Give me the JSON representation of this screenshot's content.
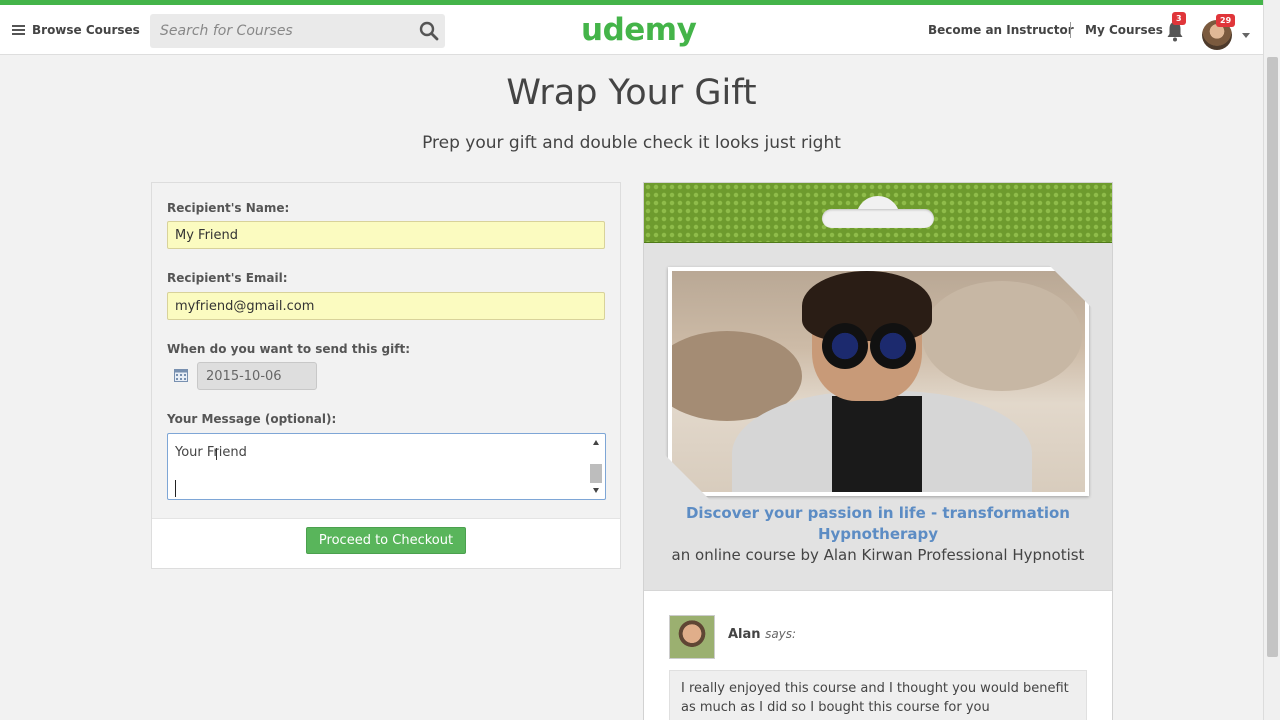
{
  "header": {
    "browse_label": "Browse Courses",
    "search_placeholder": "Search for Courses",
    "logo_text": "udemy",
    "become_instructor": "Become an Instructor",
    "my_courses": "My Courses",
    "notifications_count": "3",
    "messages_count": "29"
  },
  "page": {
    "title": "Wrap Your Gift",
    "subtitle": "Prep your gift and double check it looks just right"
  },
  "form": {
    "name_label": "Recipient's Name:",
    "name_value": "My Friend",
    "email_label": "Recipient's Email:",
    "email_value": "myfriend@gmail.com",
    "date_label": "When do you want to send this gift:",
    "date_value": "2015-10-06",
    "message_label": "Your Message (optional):",
    "message_value": "Your Friend",
    "checkout_label": "Proceed to Checkout"
  },
  "gift_card": {
    "course_title": "Discover your passion in life - transformation Hypnotherapy",
    "course_byline": "an online course by Alan Kirwan Professional Hypnotist",
    "sender_name": "Alan",
    "says_text": "says:",
    "message": "I really enjoyed this course and I thought you would benefit as much as I did so I bought this course for you"
  },
  "colors": {
    "brand_green": "#44b449",
    "checkout_green": "#59b55b",
    "link_blue": "#5c8cc4",
    "input_yellow": "#fbfbc0",
    "badge_red": "#e0363a"
  },
  "icons": [
    "menu-icon",
    "search-icon",
    "bell-icon",
    "calendar-icon",
    "avatar"
  ]
}
